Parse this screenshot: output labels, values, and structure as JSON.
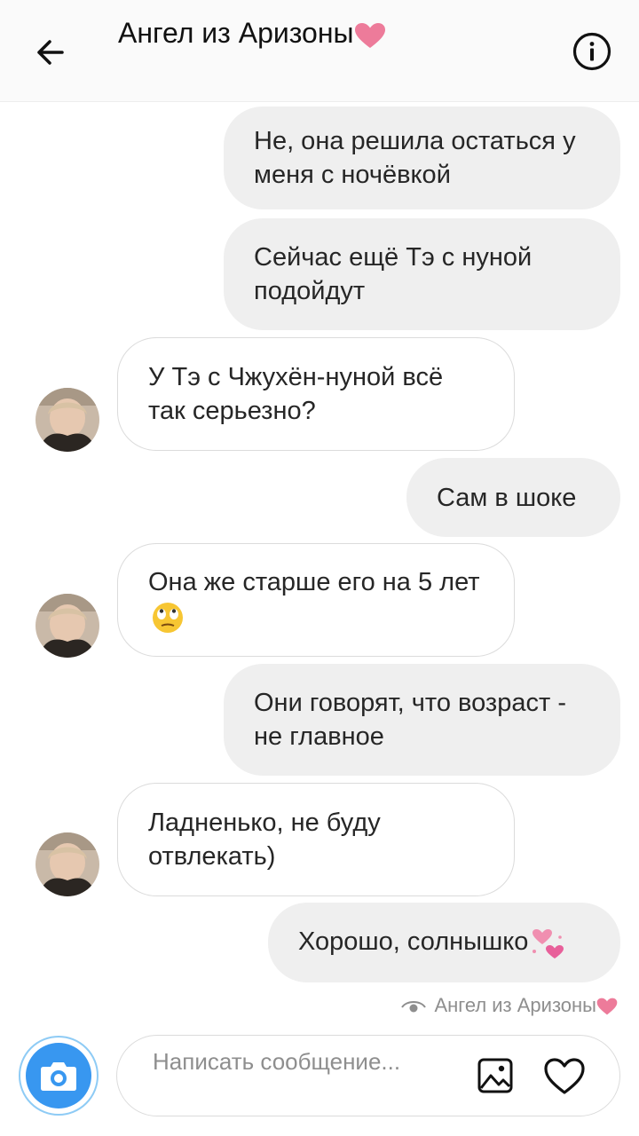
{
  "header": {
    "title": "Ангел из Аризоны",
    "back_icon": "arrow-left-icon",
    "info_icon": "info-icon"
  },
  "messages": [
    {
      "side": "out",
      "text": "Не, она решила остаться у меня с ночёвкой"
    },
    {
      "side": "out",
      "text": "Сейчас ещё Тэ с нуной подойдут"
    },
    {
      "side": "in",
      "text": "У Тэ с Чжухён-нуной всё так серьезно?"
    },
    {
      "side": "out",
      "text": "Сам в шоке"
    },
    {
      "side": "in",
      "text": "Она же старше его на 5 лет",
      "emoji": "eye-roll-emoji"
    },
    {
      "side": "out",
      "text": "Они говорят, что возраст - не главное"
    },
    {
      "side": "in",
      "text": "Ладненько, не буду отвлекать)"
    },
    {
      "side": "out",
      "text": "Хорошо, солнышко",
      "emoji": "two-hearts-emoji"
    }
  ],
  "seen_by": "Ангел из Аризоны",
  "composer": {
    "placeholder": "Написать сообщение...",
    "camera_icon": "camera-icon",
    "gallery_icon": "image-icon",
    "like_icon": "heart-icon"
  },
  "colors": {
    "accent": "#3897f0",
    "heart": "#ed7b9a",
    "outgoing_bubble": "#efefef"
  }
}
